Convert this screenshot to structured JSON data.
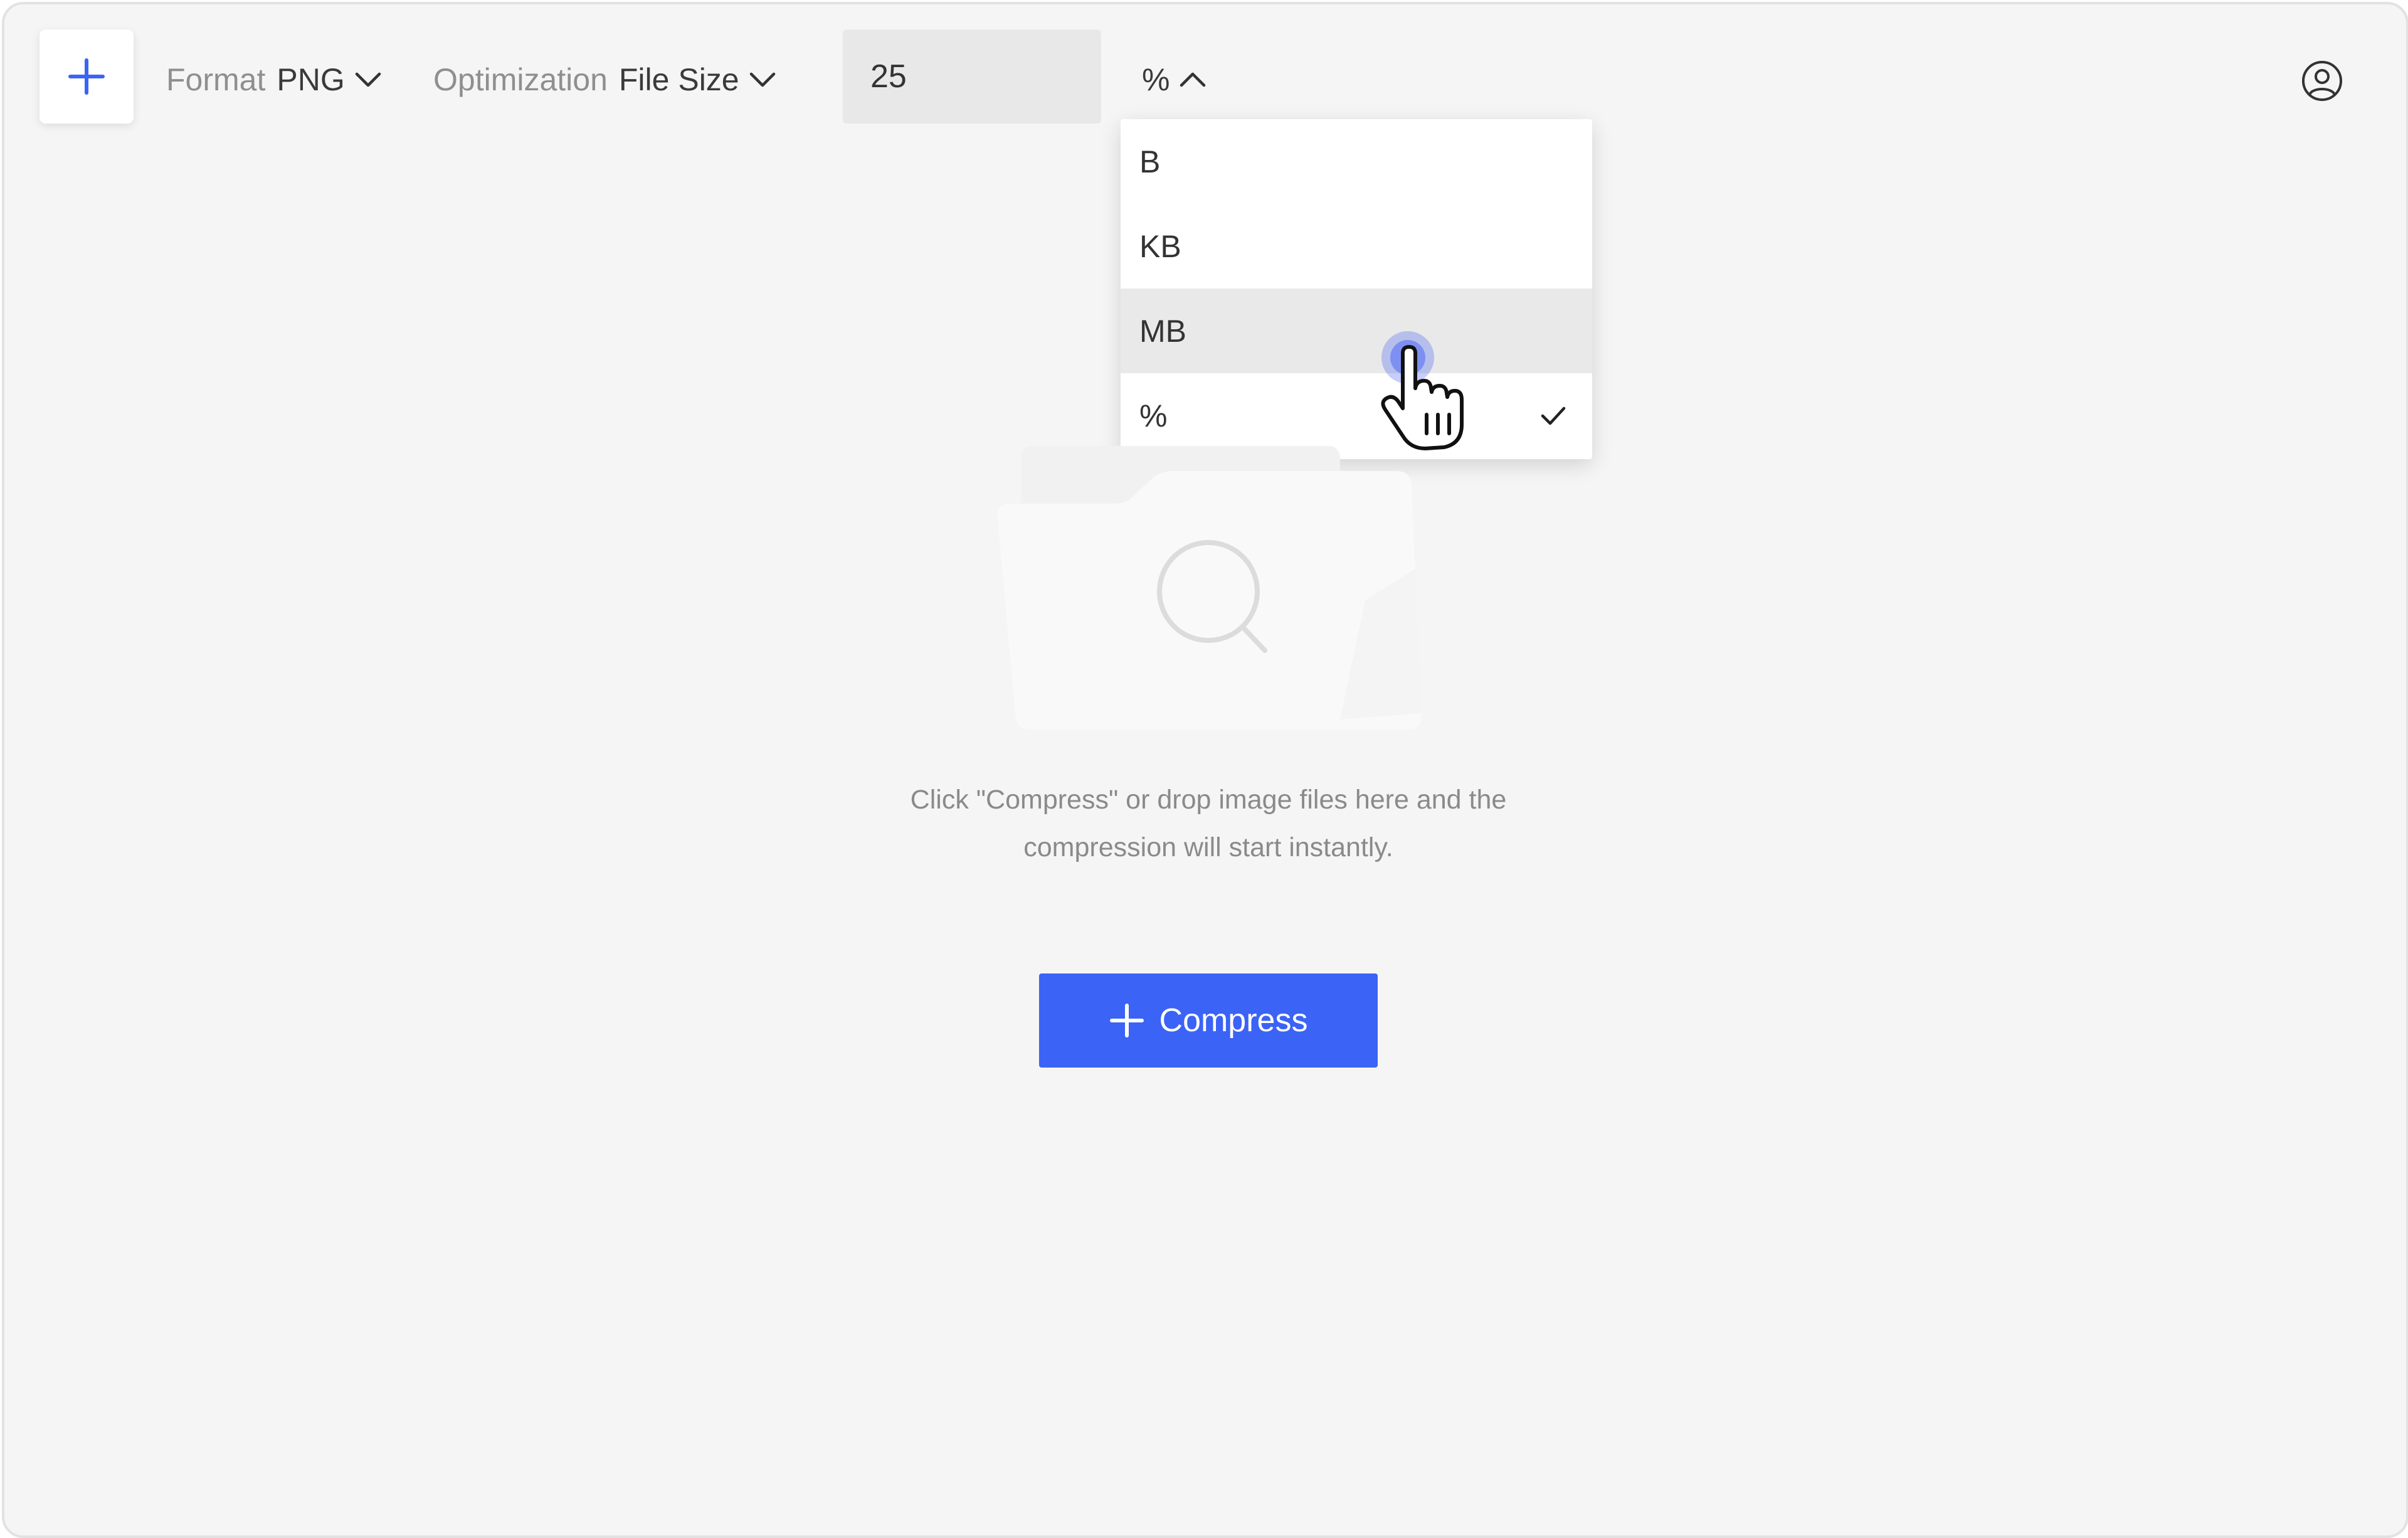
{
  "colors": {
    "accent": "#3b63f5",
    "background": "#f5f5f5",
    "hover": "#e9e9e9",
    "cursor_ring": "#5a72f0"
  },
  "toolbar": {
    "add_icon": "plus-icon",
    "format": {
      "label": "Format",
      "value": "PNG",
      "icon": "chevron-down-icon"
    },
    "optimization": {
      "label": "Optimization",
      "value": "File Size",
      "icon": "chevron-down-icon"
    },
    "target_value": "25",
    "unit": {
      "value": "%",
      "icon": "chevron-up-icon",
      "expanded": true
    },
    "user_icon": "user-circle-icon"
  },
  "unit_dropdown": {
    "items": [
      {
        "label": "B"
      },
      {
        "label": "KB"
      },
      {
        "label": "MB",
        "hovered": true
      },
      {
        "label": "%",
        "selected": true,
        "icon": "check-icon"
      }
    ]
  },
  "empty_state": {
    "illustration": "folder-search-icon",
    "hint_line1": "Click \"Compress\" or drop image files here and the",
    "hint_line2": "compression will start instantly."
  },
  "compress_button": {
    "label": "Compress",
    "icon": "plus-icon"
  },
  "pointer": {
    "icon": "hand-pointer-icon"
  }
}
